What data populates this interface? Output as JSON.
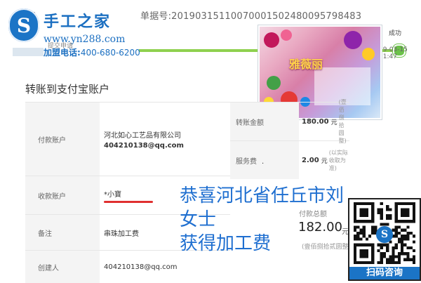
{
  "header": {
    "top_left_fragment": "提",
    "order_number": "单据号:20190315110070001502480095798483"
  },
  "logo": {
    "brand": "手工之家",
    "url": "www.yn288.com",
    "sub_fragment": "提交申请",
    "hotline_label": "加盟电话:",
    "hotline_number": "400-680-6200",
    "badge_glyph": "S"
  },
  "progress": {
    "status_label": "成功",
    "timestamp": "19-03-15 21:47",
    "accent_color": "#8fd14f"
  },
  "product_image": {
    "brand_text": "雅薇丽",
    "icon": "product-photo"
  },
  "page": {
    "section_title": "转账到支付宝账户"
  },
  "payer": {
    "label": "付款账户",
    "company": "河北如心工艺品有限公司",
    "email": "404210138@qq.com"
  },
  "payee": {
    "label": "收款账户",
    "name_masked": "*小寶"
  },
  "remark": {
    "label": "备注",
    "value": "串珠加工费"
  },
  "creator": {
    "label": "创建人",
    "value": "404210138@qq.com"
  },
  "transfer_amount": {
    "label": "转账金额",
    "value": "180.00",
    "unit": "元",
    "caps": "(壹佰捌拾圆整)"
  },
  "service_fee": {
    "label": "服务费",
    "value": "2.00",
    "unit": "元",
    "note": "(以实际收取为准)",
    "stray_mark": "."
  },
  "total": {
    "label": "付款总额",
    "value": "182.00",
    "unit": "元",
    "caps": "(壹佰捌拾贰圆整)"
  },
  "overlay": {
    "line1": "恭喜河北省任丘市刘女士",
    "line2": "获得加工费",
    "color": "#1f6fd0"
  },
  "qr": {
    "caption": "扫码咨询",
    "center_glyph": "S",
    "brand_color": "#1b74c6"
  }
}
